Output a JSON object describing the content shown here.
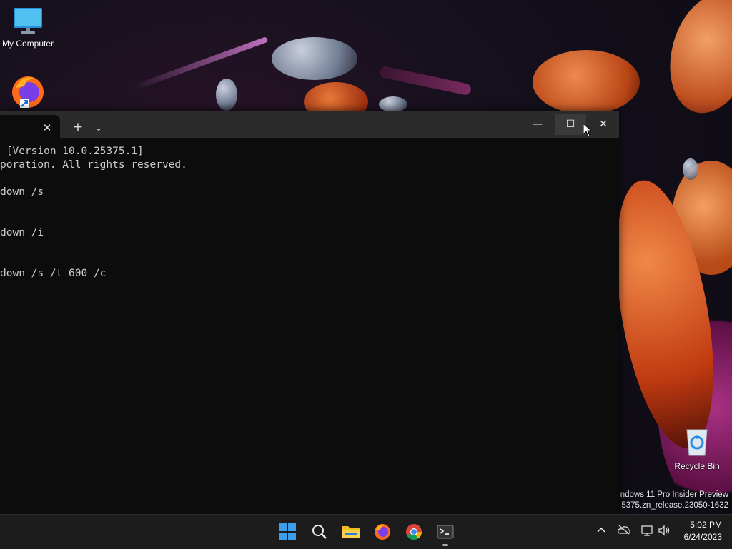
{
  "desktop": {
    "icons": [
      {
        "label": "My Computer",
        "icon": "monitor-icon"
      },
      {
        "label": "",
        "icon": "firefox-shortcut-icon"
      },
      {
        "label": "Recycle Bin",
        "icon": "recycle-bin-icon"
      }
    ],
    "watermark": {
      "line1": "ndows 11 Pro Insider Preview",
      "line2": "5375.zn_release.23050-1632"
    }
  },
  "terminal": {
    "tab": {
      "close_glyph": "✕"
    },
    "new_tab_glyph": "+",
    "dropdown_glyph": "⌄",
    "window_buttons": {
      "minimize": "—",
      "maximize": "☐",
      "close": "✕"
    },
    "lines": [
      " [Version 10.0.25375.1]",
      "poration. All rights reserved.",
      "",
      "down /s",
      "",
      "",
      "down /i",
      "",
      "",
      "down /s /t 600 /c"
    ]
  },
  "taskbar": {
    "apps": [
      "start-icon",
      "search-icon",
      "file-explorer-icon",
      "firefox-icon",
      "chrome-icon",
      "terminal-icon"
    ],
    "tray": {
      "chevron": "^"
    },
    "clock": {
      "time": "5:02 PM",
      "date": "6/24/2023"
    }
  },
  "colors": {
    "terminal_bg": "#0c0c0c",
    "titlebar_bg": "#2b2b2b",
    "taskbar_bg": "#1c1c1c",
    "start_blue": "#3a9ee8"
  }
}
